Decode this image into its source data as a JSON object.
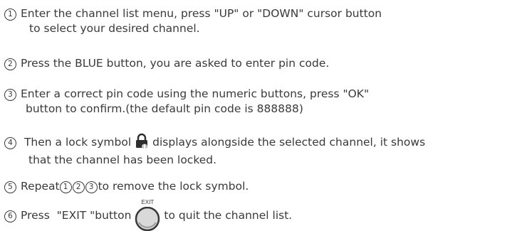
{
  "steps": [
    {
      "number": "1",
      "line1": "Enter the channel list menu, press \"UP\" or \"DOWN\" cursor button",
      "line2": "to select your desired channel."
    },
    {
      "number": "2",
      "line1": "Press the BLUE button, you are asked to enter pin code."
    },
    {
      "number": "3",
      "line1": "Enter a correct pin code using the numeric buttons, press \"OK\"",
      "line2": "button to confirm.(the default pin code is 888888)"
    },
    {
      "number": "4",
      "line1_before": "Then a lock symbol",
      "line1_after": "displays alongside the selected channel, it shows",
      "line2": "that the channel has been locked.",
      "icon": "lock-icon"
    },
    {
      "number": "5",
      "text_before": "Repeat",
      "refs": [
        "1",
        "2",
        "3"
      ],
      "text_after": "to remove the lock symbol."
    },
    {
      "number": "6",
      "text_before": "Press  \"EXIT \"button",
      "button_label": "EXIT",
      "text_after": "to quit the channel list.",
      "icon": "exit-button-icon"
    }
  ]
}
